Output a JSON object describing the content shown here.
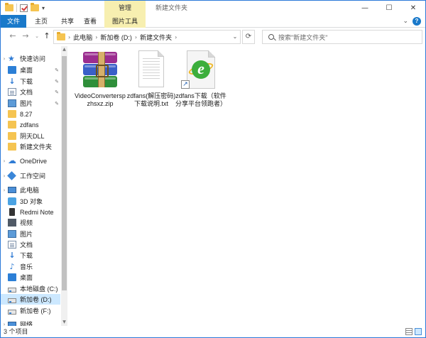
{
  "window": {
    "title": "新建文件夹",
    "context_tab_header": "管理",
    "controls": {
      "minimize": "—",
      "maximize": "☐",
      "close": "✕"
    }
  },
  "ribbon": {
    "tabs": [
      "文件",
      "主页",
      "共享",
      "查看",
      "图片工具"
    ],
    "expand": "⌄",
    "help": "?"
  },
  "navigation": {
    "back": "←",
    "forward": "→",
    "recent": "⌄",
    "up": "↑",
    "breadcrumb": [
      "此电脑",
      "新加卷 (D:)",
      "新建文件夹"
    ],
    "dropdown": "⌄",
    "refresh": "⟳",
    "search_placeholder": "搜索\"新建文件夹\""
  },
  "sidebar": {
    "items": [
      {
        "label": "快速访问",
        "icon": "star-icon",
        "type": "header"
      },
      {
        "label": "桌面",
        "icon": "desktop-icon",
        "pinned": true
      },
      {
        "label": "下载",
        "icon": "download-icon",
        "pinned": true
      },
      {
        "label": "文档",
        "icon": "document-icon",
        "pinned": true
      },
      {
        "label": "图片",
        "icon": "picture-icon",
        "pinned": true
      },
      {
        "label": "8.27",
        "icon": "folder-icon"
      },
      {
        "label": "zdfans",
        "icon": "folder-icon"
      },
      {
        "label": "阴天DLL",
        "icon": "folder-icon"
      },
      {
        "label": "新建文件夹",
        "icon": "folder-icon"
      },
      {
        "label": "OneDrive",
        "icon": "cloud-icon",
        "type": "header"
      },
      {
        "label": "工作空间",
        "icon": "workspace-icon",
        "type": "header"
      },
      {
        "label": "此电脑",
        "icon": "computer-icon",
        "type": "header"
      },
      {
        "label": "3D 对象",
        "icon": "3d-objects-icon"
      },
      {
        "label": "Redmi Note",
        "icon": "phone-icon"
      },
      {
        "label": "视频",
        "icon": "video-icon"
      },
      {
        "label": "图片",
        "icon": "picture-icon"
      },
      {
        "label": "文档",
        "icon": "document-icon"
      },
      {
        "label": "下载",
        "icon": "download-icon"
      },
      {
        "label": "音乐",
        "icon": "music-icon"
      },
      {
        "label": "桌面",
        "icon": "desktop-icon"
      },
      {
        "label": "本地磁盘 (C:)",
        "icon": "drive-icon"
      },
      {
        "label": "新加卷 (D:)",
        "icon": "drive-icon",
        "selected": true
      },
      {
        "label": "新加卷 (F:)",
        "icon": "drive-icon"
      },
      {
        "label": "网络",
        "icon": "network-icon",
        "type": "header"
      }
    ],
    "pin_glyph": "📌"
  },
  "files": [
    {
      "name": "VideoConverterspzhsxz.zip",
      "icon": "winrar-archive-icon"
    },
    {
      "name": "zdfans(解压密码)下载说明.txt",
      "icon": "text-file-icon"
    },
    {
      "name": "zdfans下载（软件分享平台领跑者）",
      "icon": "ie-shortcut-icon"
    }
  ],
  "status": {
    "item_count": "3 个项目"
  }
}
